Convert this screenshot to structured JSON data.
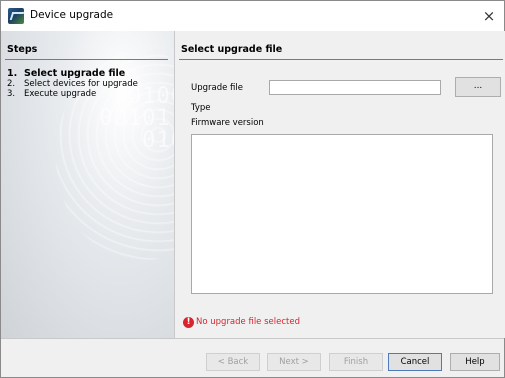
{
  "window": {
    "title": "Device upgrade",
    "close_glyph": "×",
    "icon": "app-icon"
  },
  "steps": {
    "title": "Steps",
    "items": [
      {
        "num": "1.",
        "label": "Select upgrade file",
        "active": true
      },
      {
        "num": "2.",
        "label": "Select devices for upgrade",
        "active": false
      },
      {
        "num": "3.",
        "label": "Execute upgrade",
        "active": false
      }
    ]
  },
  "main": {
    "section_title": "Select upgrade file",
    "upgrade_file_label": "Upgrade file",
    "upgrade_file_value": "",
    "browse_label": "...",
    "type_label": "Type",
    "firmware_label": "Firmware version",
    "error_icon": "error-icon",
    "error_text": "No upgrade file selected",
    "error_color": "#d9232e"
  },
  "buttons": {
    "back": "< Back",
    "next": "Next >",
    "finish": "Finish",
    "cancel": "Cancel",
    "help": "Help"
  }
}
